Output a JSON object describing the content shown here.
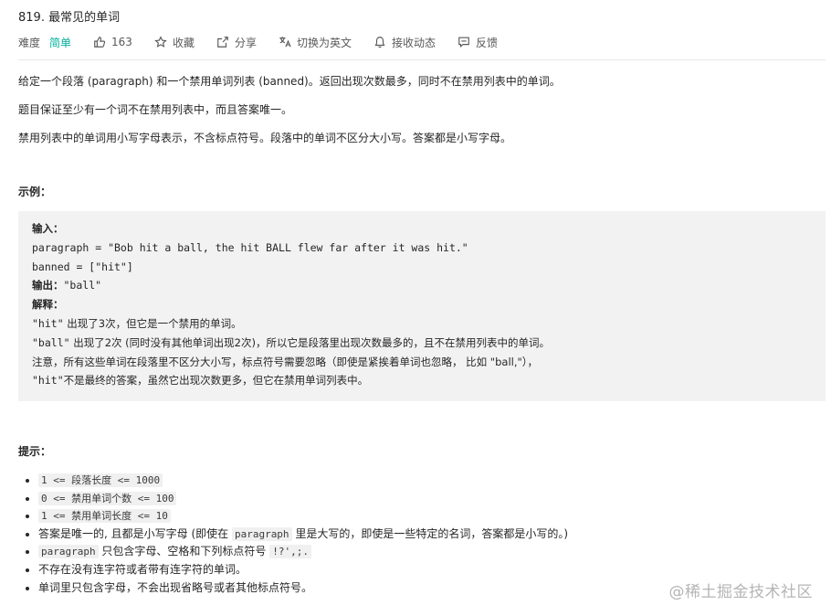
{
  "problem": {
    "title": "819. 最常见的单词",
    "difficulty_label": "难度",
    "difficulty_value": "简单",
    "likes": "163",
    "favorite_label": "收藏",
    "share_label": "分享",
    "switch_lang_label": "切换为英文",
    "notify_label": "接收动态",
    "feedback_label": "反馈"
  },
  "description": {
    "p1": "给定一个段落 (paragraph) 和一个禁用单词列表 (banned)。返回出现次数最多，同时不在禁用列表中的单词。",
    "p2": "题目保证至少有一个词不在禁用列表中，而且答案唯一。",
    "p3": "禁用列表中的单词用小写字母表示，不含标点符号。段落中的单词不区分大小写。答案都是小写字母。"
  },
  "example": {
    "title": "示例：",
    "input_label": "输入：",
    "paragraph_line": "paragraph = \"Bob hit a ball, the hit BALL flew far after it was hit.\"",
    "banned_line": "banned = [\"hit\"]",
    "output_label": "输出：",
    "output_value": "\"ball\"",
    "explain_label": "解释：",
    "explain_1a": "\"hit\"",
    "explain_1b": " 出现了3次，但它是一个禁用的单词。",
    "explain_2a": "\"ball\"",
    "explain_2b": " 出现了2次 (同时没有其他单词出现2次)，所以它是段落里出现次数最多的，且不在禁用列表中的单词。",
    "explain_3": "注意，所有这些单词在段落里不区分大小写，标点符号需要忽略（即使是紧挨着单词也忽略， 比如 \"ball,\"），",
    "explain_4a": "\"hit\"",
    "explain_4b": "不是最终的答案，虽然它出现次数更多，但它在禁用单词列表中。"
  },
  "hints": {
    "title": "提示：",
    "h1_code": "1 <= 段落长度 <= 1000",
    "h2_code": "0 <= 禁用单词个数 <= 100",
    "h3_code": "1 <= 禁用单词长度 <= 10",
    "h4a": "答案是唯一的, 且都是小写字母 (即使在 ",
    "h4_code": "paragraph",
    "h4b": " 里是大写的，即使是一些特定的名词，答案都是小写的。)",
    "h5_code": "paragraph",
    "h5a": " 只包含字母、空格和下列标点符号",
    "h5_code2": "!?',;.",
    "h6": "不存在没有连字符或者带有连字符的单词。",
    "h7": "单词里只包含字母，不会出现省略号或者其他标点符号。"
  },
  "watermark": "@稀土掘金技术社区",
  "colors": {
    "easy": "#00af9b",
    "code_bg": "#f2f2f2"
  },
  "icons": [
    "thumbs-up-icon",
    "star-icon",
    "share-icon",
    "translate-icon",
    "bell-icon",
    "feedback-icon"
  ]
}
